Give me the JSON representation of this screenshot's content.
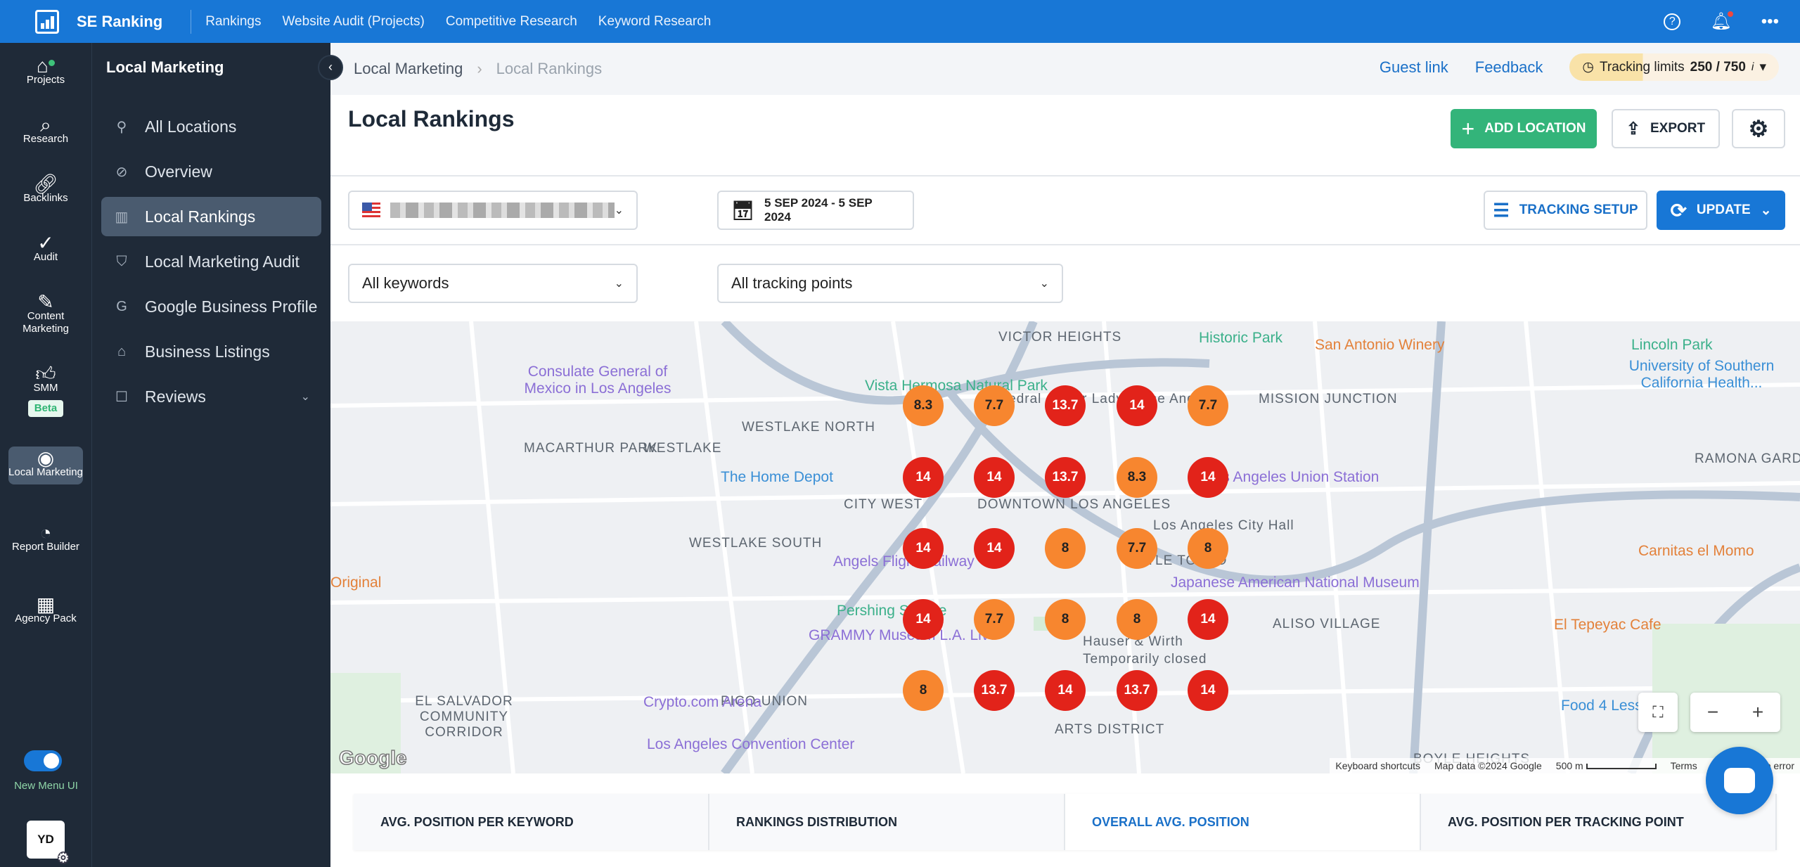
{
  "topbar": {
    "brand": "SE Ranking",
    "nav": [
      "Rankings",
      "Website Audit (Projects)",
      "Competitive Research",
      "Keyword Research"
    ],
    "icons": [
      "help-icon",
      "bell-icon",
      "more-icon"
    ]
  },
  "rail": {
    "items": [
      {
        "label": "Projects",
        "icon": "home-icon"
      },
      {
        "label": "Research",
        "icon": "research-icon"
      },
      {
        "label": "Backlinks",
        "icon": "link-icon"
      },
      {
        "label": "Audit",
        "icon": "check-circle-icon"
      },
      {
        "label": "Content Marketing",
        "icon": "edit-icon"
      },
      {
        "label": "SMM",
        "icon": "thumbs-up-icon",
        "badge": "Beta"
      },
      {
        "label": "Local Marketing",
        "icon": "location-icon",
        "active": true
      },
      {
        "label": "Report Builder",
        "icon": "pie-chart-icon"
      },
      {
        "label": "Agency Pack",
        "icon": "building-icon"
      }
    ],
    "toggle_label": "New Menu UI",
    "toggle_on": true,
    "avatar": "YD"
  },
  "sidebar": {
    "title": "Local Marketing",
    "items": [
      {
        "label": "All Locations",
        "icon": "pin-icon"
      },
      {
        "label": "Overview",
        "icon": "compass-icon"
      },
      {
        "label": "Local Rankings",
        "icon": "bar-chart-icon",
        "active": true
      },
      {
        "label": "Local Marketing Audit",
        "icon": "shield-check-icon"
      },
      {
        "label": "Google Business Profile",
        "icon": "google-icon"
      },
      {
        "label": "Business Listings",
        "icon": "store-icon"
      },
      {
        "label": "Reviews",
        "icon": "review-icon",
        "expandable": true
      }
    ]
  },
  "header": {
    "breadcrumb": [
      "Local Marketing",
      "Local Rankings"
    ],
    "guest_link": "Guest link",
    "feedback": "Feedback",
    "limits_label": "Tracking limits",
    "limits_value": "250 / 750",
    "limits_used": 250,
    "limits_total": 750
  },
  "page": {
    "title": "Local Rankings",
    "add_location": "ADD LOCATION",
    "export": "EXPORT"
  },
  "filters": {
    "date_range": "5 SEP 2024 - 5 SEP 2024",
    "tracking_setup": "TRACKING SETUP",
    "update": "UPDATE",
    "keywords": "All keywords",
    "tracking_points": "All tracking points"
  },
  "map": {
    "colors": {
      "good": "#f7862f",
      "bad": "#e2231a"
    },
    "grid": [
      [
        8.3,
        7.7,
        13.7,
        14,
        7.7
      ],
      [
        14,
        14,
        13.7,
        8.3,
        14
      ],
      [
        14,
        14,
        8,
        7.7,
        8
      ],
      [
        14,
        7.7,
        8,
        8,
        14
      ],
      [
        8,
        13.7,
        14,
        13.7,
        14
      ]
    ],
    "labels": [
      "VICTOR HEIGHTS",
      "Historic Park",
      "San Antonio Winery",
      "Lincoln Park",
      "Consulate General of Mexico in Los Angeles",
      "MACARTHUR PARK",
      "WESTLAKE",
      "WESTLAKE NORTH",
      "Vista Hermosa Natural Park",
      "Cathedral of Our Lady of the Angels",
      "MISSION JUNCTION",
      "University of Southern California Health...",
      "The Home Depot",
      "CITY WEST",
      "DOWNTOWN LOS ANGELES",
      "Los Angeles Union Station",
      "RAMONA GARDENS",
      "WESTLAKE SOUTH",
      "Angels Flight Railway",
      "LITTLE TOKYO",
      "Los Angeles City Hall",
      "Carnitas el Momo",
      "Japanese American National Museum",
      "Pershing Square",
      "ALISO VILLAGE",
      "El Tepeyac Cafe",
      "GRAMMY Museum L.A. Live",
      "Hauser & Wirth",
      "Temporarily closed",
      "PICO-UNION",
      "Crypto.com Arena",
      "EL SALVADOR COMMUNITY CORRIDOR",
      "Los Angeles Convention Center",
      "ARTS DISTRICT",
      "Food 4 Less",
      "BOYLE HEIGHTS",
      "Original"
    ],
    "attribution": [
      "Keyboard shortcuts",
      "Map data ©2024 Google",
      "500 m",
      "Terms",
      "Report a map error"
    ],
    "google": "Google"
  },
  "tabs": [
    {
      "label": "AVG. POSITION PER KEYWORD"
    },
    {
      "label": "RANKINGS DISTRIBUTION"
    },
    {
      "label": "OVERALL AVG. POSITION",
      "active": true
    },
    {
      "label": "AVG. POSITION PER TRACKING POINT"
    }
  ]
}
